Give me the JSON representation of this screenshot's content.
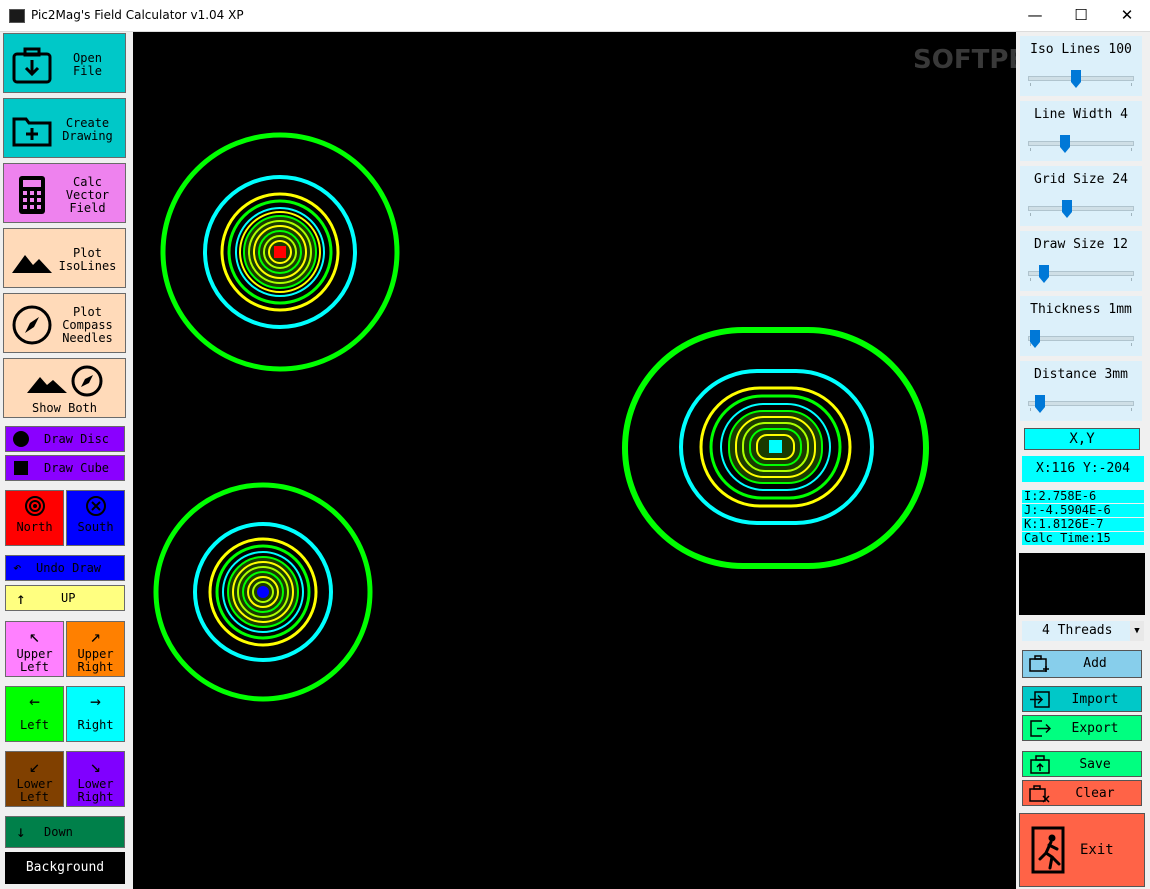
{
  "window": {
    "title": "Pic2Mag's Field Calculator v1.04 XP",
    "minimize_glyph": "—",
    "maximize_glyph": "☐",
    "close_glyph": "✕"
  },
  "watermark": "SOFTPEDIA",
  "left_panel": {
    "open_file": "Open\nFile",
    "create_drawing": "Create\nDrawing",
    "calc_vector_field": "Calc\nVector\nField",
    "plot_isolines": "Plot\nIsoLines",
    "plot_compass_needles": "Plot\nCompass\nNeedles",
    "show_both": "Show Both",
    "draw_disc": "Draw Disc",
    "draw_cube": "Draw Cube",
    "north": "North",
    "south": "South",
    "undo_draw": "Undo Draw",
    "up": "UP",
    "upper_left": "Upper\nLeft",
    "upper_right": "Upper\nRight",
    "left": "Left",
    "right": "Right",
    "lower_left": "Lower\nLeft",
    "lower_right": "Lower\nRight",
    "down": "Down",
    "background": "Background"
  },
  "right_panel": {
    "sliders": [
      {
        "label": "Iso Lines 100",
        "level": 0.45
      },
      {
        "label": "Line Width 4",
        "level": 0.33
      },
      {
        "label": "Grid Size 24",
        "level": 0.35
      },
      {
        "label": "Draw Size 12",
        "level": 0.1
      },
      {
        "label": "Thickness 1mm",
        "level": 0.0
      },
      {
        "label": "Distance 3mm",
        "level": 0.05
      }
    ],
    "xy_header": "X,Y",
    "xy_value": "X:116 Y:-204",
    "vector_i": "I:2.758E-6",
    "vector_j": "J:-4.5904E-6",
    "vector_k": "K:1.8126E-7",
    "calc_time": "Calc Time:15",
    "threads_value": "4 Threads",
    "add": "Add",
    "import": "Import",
    "export": "Export",
    "save": "Save",
    "clear": "Clear",
    "exit": "Exit"
  },
  "colors": {
    "open_file_bg": "#00c8c8",
    "calc_bg": "#ee82ee",
    "peach_bg": "#ffdab9",
    "purple_btn": "#8a00ff",
    "north_bg": "#ff0000",
    "south_bg": "#0000ff",
    "canvas_bg": "#000000",
    "contour_outer": "#00ff00",
    "contour_cyan": "#00ffff",
    "contour_yellow": "#ffff00"
  }
}
